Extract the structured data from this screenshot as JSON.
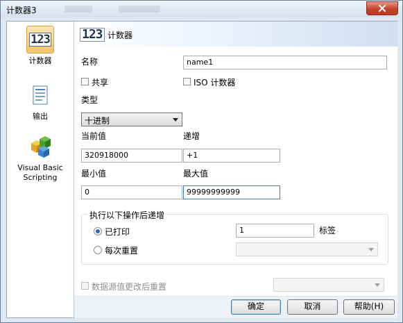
{
  "window": {
    "title": "计数器3",
    "close_icon": "close-icon"
  },
  "sidebar": {
    "items": [
      {
        "label": "计数器",
        "icon": "counter-icon"
      },
      {
        "label": "输出",
        "icon": "document-icon"
      },
      {
        "label": "Visual Basic\nScripting",
        "icon": "vbscript-blocks-icon"
      }
    ]
  },
  "header": {
    "icon_text": "123",
    "title": "计数器"
  },
  "form": {
    "name_label": "名称",
    "name_value": "name1",
    "shared_label": "共享",
    "iso_label": "ISO 计数器",
    "type_label": "类型",
    "type_value": "十进制",
    "current_label": "当前值",
    "current_value": "320918000",
    "increment_label": "递增",
    "increment_value": "+1",
    "min_label": "最小值",
    "min_value": "0",
    "max_label": "最大值",
    "max_value": "99999999999"
  },
  "increment_group": {
    "title": "执行以下操作后递增",
    "printed_label": "已打印",
    "printed_value": "1",
    "labels_suffix": "标签",
    "each_reprint_label": "每次重置",
    "each_reprint_select": ""
  },
  "reset_option": {
    "label": "数据源值更改后重置",
    "select_value": ""
  },
  "buttons": {
    "ok": "确定",
    "cancel": "取消",
    "help": "帮助(H)"
  },
  "colors": {
    "accent": "#2d6bb8",
    "close_button": "#c8432b",
    "selected_sidebar": "#f2c46a"
  }
}
